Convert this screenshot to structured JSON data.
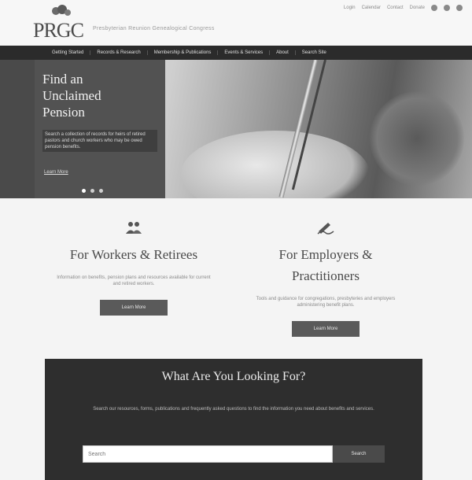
{
  "header": {
    "logo_text": "PRGC",
    "tagline": "Presbyterian Reunion Genealogical Congress",
    "utility_links": [
      "Login",
      "Calendar",
      "Contact",
      "Donate"
    ]
  },
  "nav": {
    "items": [
      "Getting Started",
      "Records & Research",
      "Membership & Publications",
      "Events & Services",
      "About",
      "Search Site"
    ]
  },
  "hero": {
    "title": "Find an Unclaimed Pension",
    "description": "Search a collection of records for heirs of retired pastors and church workers who may be owed pension benefits.",
    "link": "Learn More"
  },
  "columns": [
    {
      "icon": "people-icon",
      "title": "For Workers & Retirees",
      "description": "Information on benefits, pension plans and resources available for current and retired workers.",
      "button": "Learn More"
    },
    {
      "icon": "signature-icon",
      "title": "For Employers & Practitioners",
      "description": "Tools and guidance for congregations, presbyteries and employers administering benefit plans.",
      "button": "Learn More"
    }
  ],
  "search": {
    "title": "What Are You Looking For?",
    "description": "Search our resources, forms, publications and frequently asked questions to find the information you need about benefits and services.",
    "placeholder": "Search",
    "button": "Search"
  }
}
